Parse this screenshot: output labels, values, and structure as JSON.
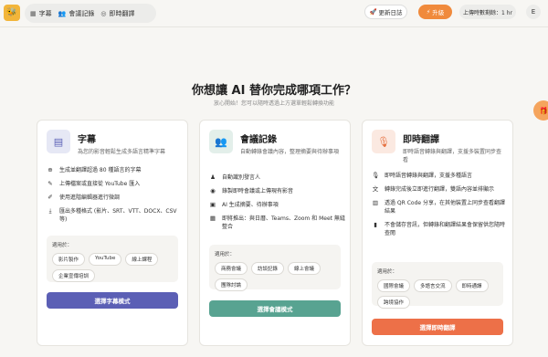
{
  "app": {
    "logo_text": "🐝"
  },
  "nav": {
    "items": [
      {
        "icon": "▦",
        "label": "字幕"
      },
      {
        "icon": "👥",
        "label": "會議記錄"
      },
      {
        "icon": "◎",
        "label": "即時翻譯"
      }
    ]
  },
  "header": {
    "updates_icon": "🚀",
    "updates_label": "更新日誌",
    "upgrade_icon": "⚡",
    "upgrade_label": "升級",
    "quota_label": "上傳時數剩餘：1 hr",
    "avatar_letter": "E"
  },
  "main": {
    "heading": "你想讓 AI 替你完成哪項工作？",
    "subheading": "放心開始！您可以隨時透過上方選單輕鬆轉換功能"
  },
  "cards": [
    {
      "title": "字幕",
      "desc": "為您的影音輕鬆生成多語言精準字幕",
      "icon": "▤",
      "icon_bg": "#e6e8f5",
      "icon_color": "#5b61b6",
      "features": [
        {
          "icon": "⊕",
          "text": "生成並翻譯超過 80 種語言的字幕"
        },
        {
          "icon": "✎",
          "text": "上傳檔案或直接從 YouTube 匯入"
        },
        {
          "icon": "✐",
          "text": "使用進階編輯器進行微調"
        },
        {
          "icon": "⤓",
          "text": "匯出多種格式 (影片、SRT、VTT、DOCX、CSV 等)"
        }
      ],
      "use_label": "適用於：",
      "tags": [
        "影片製作",
        "YouTube",
        "線上課程",
        "企業宣傳培訓"
      ],
      "button_label": "選擇字幕模式",
      "button_color": "#5b5fb5"
    },
    {
      "title": "會議記錄",
      "desc": "自動轉錄會議內容，整理摘要與待辦事項",
      "icon": "👥",
      "icon_bg": "#e3efea",
      "icon_color": "#4e9e84",
      "features": [
        {
          "icon": "♟",
          "text": "自動識別發言人"
        },
        {
          "icon": "◉",
          "text": "錄製即時會議或上傳現有影音"
        },
        {
          "icon": "▣",
          "text": "AI 生成摘要、待辦事項"
        },
        {
          "icon": "▦",
          "text": "即將推出：與日曆、Teams、Zoom 和 Meet 無縫整合"
        }
      ],
      "use_label": "適用於：",
      "tags": [
        "商務會議",
        "訪談記錄",
        "線上會議",
        "團隊討論"
      ],
      "button_label": "選擇會議模式",
      "button_color": "#58a391"
    },
    {
      "title": "即時翻譯",
      "desc": "即時語音轉錄與翻譯，支援多裝置同步查看",
      "icon": "🎙",
      "icon_bg": "#fbe9e1",
      "icon_color": "#e6703f",
      "features": [
        {
          "icon": "🎙",
          "text": "即時語音轉錄與翻譯，支援多種語言"
        },
        {
          "icon": "文",
          "text": "轉錄完成後立即進行翻譯，雙語內容並排顯示"
        },
        {
          "icon": "▥",
          "text": "透過 QR Code 分享，在其他裝置上同步查看翻譯結果"
        },
        {
          "icon": "▮",
          "text": "不會儲存音訊，但轉錄和翻譯結果會保留供您隨時查閱"
        }
      ],
      "use_label": "適用於：",
      "tags": [
        "國際會議",
        "多語言交流",
        "即時通譯",
        "跨境協作"
      ],
      "button_label": "選擇即時翻譯",
      "button_color": "#ed7048"
    }
  ],
  "side": {
    "icon": "🎁"
  }
}
